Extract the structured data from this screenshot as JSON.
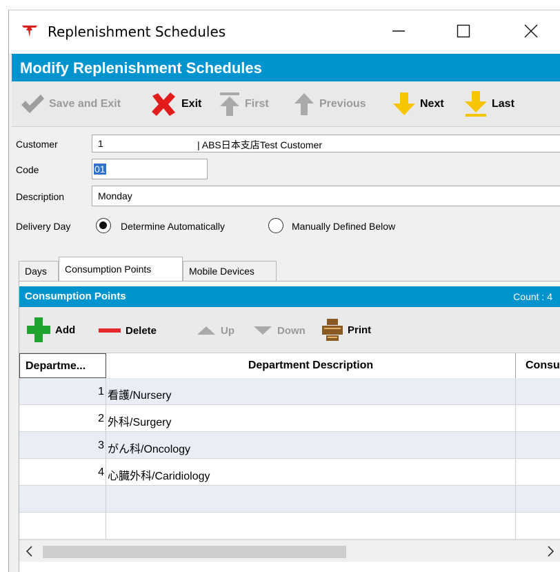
{
  "window": {
    "title": "Replenishment Schedules",
    "controls": {
      "minimize": "—",
      "maximize": "☐",
      "close": "✕"
    }
  },
  "header": {
    "title": "Modify Replenishment Schedules"
  },
  "toolbar": {
    "save_exit": "Save and Exit",
    "exit": "Exit",
    "first": "First",
    "previous": "Previous",
    "next": "Next",
    "last": "Last"
  },
  "form": {
    "customer_label": "Customer",
    "customer_code": "1",
    "customer_name": "| ABS日本支店Test Customer",
    "code_label": "Code",
    "code_value": "01",
    "description_label": "Description",
    "description_value": "Monday",
    "delivery_day_label": "Delivery Day",
    "delivery_options": [
      "Determine Automatically",
      "Manually Defined Below"
    ],
    "delivery_selected": "Determine Automatically"
  },
  "tabs": [
    {
      "label": "Days",
      "active": false
    },
    {
      "label": "Consumption Points",
      "active": true
    },
    {
      "label": "Mobile Devices",
      "active": false
    }
  ],
  "panel": {
    "title": "Consumption Points",
    "count": "Count : 4",
    "toolbar": {
      "add": "Add",
      "delete": "Delete",
      "up": "Up",
      "down": "Down",
      "print": "Print"
    },
    "columns": [
      "Departme...",
      "Department Description",
      "Consu"
    ],
    "rows": [
      {
        "num": "1",
        "desc": "看護/Nursery"
      },
      {
        "num": "2",
        "desc": "外科/Surgery"
      },
      {
        "num": "3",
        "desc": "がん科/Oncology"
      },
      {
        "num": "4",
        "desc": "心臓外科/Caridiology"
      }
    ]
  },
  "scrollbar": {
    "left_arrow": "<",
    "right_arrow": ">"
  },
  "colors": {
    "accent_blue": "#0094ce",
    "add_green": "#1fa52f",
    "delete_red": "#e32b2b",
    "nav_yellow": "#f7c400",
    "exit_red": "#e21b1b",
    "print_brown": "#8a5a24"
  }
}
